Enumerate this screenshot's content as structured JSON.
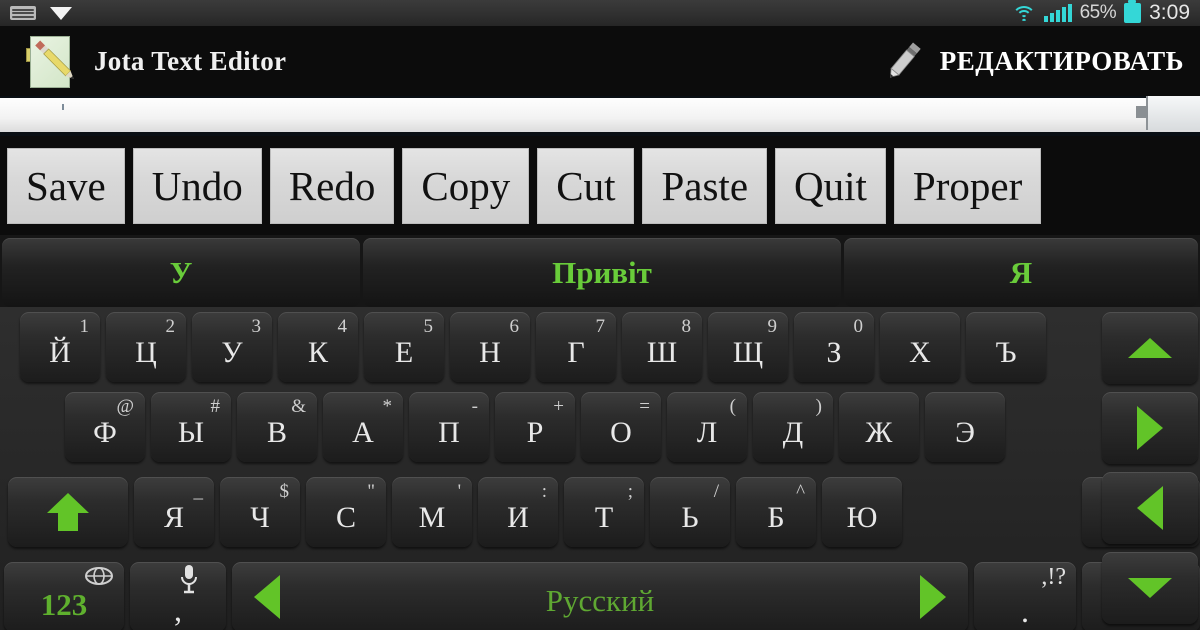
{
  "status_bar": {
    "left_icons": [
      "keyboard-icon",
      "download-chevron-icon"
    ],
    "wifi_icon": "wifi-icon",
    "signal_icon": "signal-bars-icon",
    "battery_percent": "65%",
    "battery_icon": "battery-icon",
    "clock": "3:09",
    "accent_cyan": "#34d7d7"
  },
  "title_bar": {
    "app_icon": "jota-app-icon",
    "title": "Jota Text Editor",
    "action_icon": "pencil-icon",
    "action_label": "РЕДАКТИРОВАТЬ"
  },
  "editor": {
    "value": "",
    "placeholder": ""
  },
  "toolbar": {
    "buttons": [
      {
        "label": "Save"
      },
      {
        "label": "Undo"
      },
      {
        "label": "Redo"
      },
      {
        "label": "Copy"
      },
      {
        "label": "Cut"
      },
      {
        "label": "Paste"
      },
      {
        "label": "Quit"
      },
      {
        "label": "Proper"
      }
    ]
  },
  "suggestions": {
    "accent": "#69cc3a",
    "items": [
      {
        "label": "У"
      },
      {
        "label": "Привіт"
      },
      {
        "label": "Я"
      }
    ]
  },
  "keyboard": {
    "accent_green": "#62c428",
    "language": "Русский",
    "numeric_label": "123",
    "comma_label": ",",
    "period_label": ".",
    "period_alt": ",!?",
    "row1": [
      {
        "main": "Й",
        "alt": "1"
      },
      {
        "main": "Ц",
        "alt": "2"
      },
      {
        "main": "У",
        "alt": "3"
      },
      {
        "main": "К",
        "alt": "4"
      },
      {
        "main": "Е",
        "alt": "5"
      },
      {
        "main": "Н",
        "alt": "6"
      },
      {
        "main": "Г",
        "alt": "7"
      },
      {
        "main": "Ш",
        "alt": "8"
      },
      {
        "main": "Щ",
        "alt": "9"
      },
      {
        "main": "З",
        "alt": "0"
      },
      {
        "main": "Х",
        "alt": ""
      },
      {
        "main": "Ъ",
        "alt": ""
      }
    ],
    "row2": [
      {
        "main": "Ф",
        "alt": "@"
      },
      {
        "main": "Ы",
        "alt": "#"
      },
      {
        "main": "В",
        "alt": "&"
      },
      {
        "main": "А",
        "alt": "*"
      },
      {
        "main": "П",
        "alt": "-"
      },
      {
        "main": "Р",
        "alt": "+"
      },
      {
        "main": "О",
        "alt": "="
      },
      {
        "main": "Л",
        "alt": "("
      },
      {
        "main": "Д",
        "alt": ")"
      },
      {
        "main": "Ж",
        "alt": ""
      },
      {
        "main": "Э",
        "alt": ""
      }
    ],
    "row3": [
      {
        "main": "Я",
        "alt": "_"
      },
      {
        "main": "Ч",
        "alt": "$"
      },
      {
        "main": "С",
        "alt": "\""
      },
      {
        "main": "М",
        "alt": "'"
      },
      {
        "main": "И",
        "alt": ":"
      },
      {
        "main": "Т",
        "alt": ";"
      },
      {
        "main": "Ь",
        "alt": "/"
      },
      {
        "main": "Б",
        "alt": "^"
      },
      {
        "main": "Ю",
        "alt": ""
      }
    ],
    "special_keys": {
      "shift": "shift-icon",
      "backspace": "backspace-icon",
      "enter": "enter-icon",
      "emoji": "emoji-icon",
      "mic": "microphone-icon",
      "globe": "globe-icon"
    },
    "arrow_keys": [
      "arrow-up",
      "arrow-right",
      "arrow-left",
      "arrow-down"
    ]
  }
}
